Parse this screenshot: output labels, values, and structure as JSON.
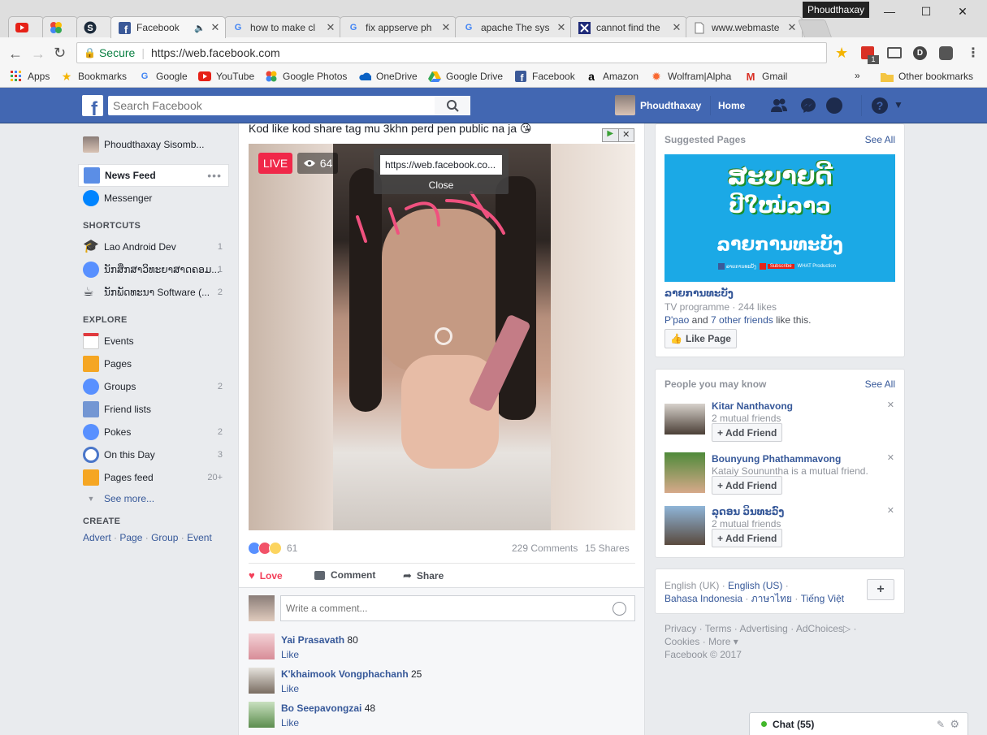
{
  "browser": {
    "tabs": [
      {
        "title": "",
        "icon": "youtube-icon"
      },
      {
        "title": "",
        "icon": "photos-icon"
      },
      {
        "title": "",
        "icon": "s-icon"
      },
      {
        "title": "Facebook",
        "icon": "facebook-icon"
      },
      {
        "title": "how to make cl",
        "icon": "google-icon"
      },
      {
        "title": "fix appserve ph",
        "icon": "google-icon"
      },
      {
        "title": "apache The sys",
        "icon": "google-icon"
      },
      {
        "title": "cannot find the",
        "icon": "puzzle-icon"
      },
      {
        "title": "www.webmaste",
        "icon": "page-icon"
      }
    ],
    "profile_name": "Phoudthaxay",
    "secure_label": "Secure",
    "url": "https://web.facebook.com",
    "bookmarks": [
      "Apps",
      "Bookmarks",
      "Google",
      "YouTube",
      "Google Photos",
      "OneDrive",
      "Google Drive",
      "Facebook",
      "Amazon",
      "Wolfram|Alpha",
      "Gmail"
    ],
    "more_bookmarks": "»",
    "other_bookmarks": "Other bookmarks",
    "ext_badge": "1"
  },
  "fb": {
    "search_placeholder": "Search Facebook",
    "user_first": "Phoudthaxay",
    "home": "Home"
  },
  "left": {
    "profile": "Phoudthaxay Sisomb...",
    "news_feed": "News Feed",
    "messenger": "Messenger",
    "shortcuts_title": "SHORTCUTS",
    "shortcuts": [
      {
        "label": "Lao Android Dev",
        "count": "1"
      },
      {
        "label": "ນັກສຶກສາວິທະຍາສາດຄອມ...",
        "count": "1"
      },
      {
        "label": "ນັກພັດທະນາ Software (...",
        "count": "2"
      }
    ],
    "explore_title": "EXPLORE",
    "explore": [
      {
        "label": "Events",
        "count": ""
      },
      {
        "label": "Pages",
        "count": ""
      },
      {
        "label": "Groups",
        "count": "2"
      },
      {
        "label": "Friend lists",
        "count": ""
      },
      {
        "label": "Pokes",
        "count": "2"
      },
      {
        "label": "On this Day",
        "count": "3"
      },
      {
        "label": "Pages feed",
        "count": "20+"
      }
    ],
    "see_more": "See more...",
    "create_title": "CREATE",
    "create_links": [
      "Advert",
      "Page",
      "Group",
      "Event"
    ]
  },
  "post": {
    "caption": "Kod like kod share tag mu 3khn perd pen public na ja 😘",
    "live": "LIVE",
    "viewers": "64",
    "popup_url": "https://web.facebook.co...",
    "popup_close": "Close",
    "reaction_count": "61",
    "comments": "229 Comments",
    "shares": "15 Shares",
    "love": "Love",
    "comment": "Comment",
    "share": "Share",
    "comment_placeholder": "Write a comment...",
    "comment_list": [
      {
        "name": "Yai Prasavath",
        "text": "80",
        "like": "Like"
      },
      {
        "name": "K'khaimook Vongphachanh",
        "text": "25",
        "like": "Like"
      },
      {
        "name": "Bo Seepavongzai",
        "text": "48",
        "like": "Like"
      }
    ]
  },
  "suggested": {
    "title": "Suggested Pages",
    "see_all": "See All",
    "banner_line1": "ສະບາຍດີ",
    "banner_line2": "ປີໃໝ່ລາວ",
    "banner_line3": "ລາຍການທະບັງ",
    "banner_subscribe": "Subscribe",
    "banner_credit": "WHAT Production",
    "banner_small_name": "ລາຍການທະບັງ",
    "page_name": "ລາຍການທະບັງ",
    "category": "TV programme · 244 likes",
    "friend1": "P'pao",
    "and": " and ",
    "friend2": "7 other friends",
    "like_this": " like this.",
    "like_page": "Like Page"
  },
  "pymk": {
    "title": "People you may know",
    "see_all": "See All",
    "people": [
      {
        "name": "Kitar Nanthavong",
        "mutual": "2 mutual friends",
        "button": "Add Friend"
      },
      {
        "name": "Bounyung Phathammavong",
        "mutual": "Kataiy Soununtha is a mutual friend.",
        "button": "Add Friend"
      },
      {
        "name": "ລຸດອນ ວິນທະວົງ",
        "mutual": "2 mutual friends",
        "button": "Add Friend"
      }
    ]
  },
  "languages": {
    "current": "English (UK)",
    "links": [
      "English (US)",
      "Bahasa Indonesia",
      "ภาษาไทย",
      "Tiếng Việt"
    ],
    "plus": "+"
  },
  "footer": {
    "links": [
      "Privacy",
      "Terms",
      "Advertising",
      "AdChoices",
      "Cookies",
      "More"
    ],
    "more_arrow": "▾",
    "copyright": "Facebook © 2017"
  },
  "chat": {
    "label": "Chat (55)"
  },
  "colors": {
    "fb_blue": "#4267b2",
    "live_red": "#f02849",
    "link": "#365899"
  }
}
